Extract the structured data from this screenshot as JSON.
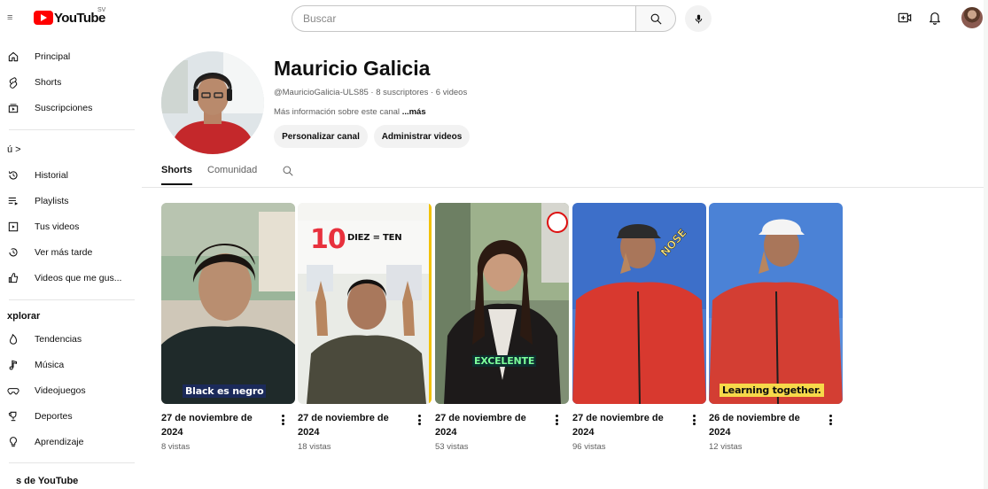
{
  "topbar": {
    "logo_text": "YouTube",
    "logo_country": "SV",
    "search_placeholder": "Buscar"
  },
  "sidebar": {
    "main_items": [
      {
        "label": "Principal",
        "icon": "home-icon"
      },
      {
        "label": "Shorts",
        "icon": "shorts-icon"
      },
      {
        "label": "Suscripciones",
        "icon": "subscriptions-icon"
      }
    ],
    "you_header": "ú  >",
    "you_items": [
      {
        "label": "Historial",
        "icon": "history-icon"
      },
      {
        "label": "Playlists",
        "icon": "playlists-icon"
      },
      {
        "label": "Tus videos",
        "icon": "your-videos-icon"
      },
      {
        "label": "Ver más tarde",
        "icon": "watch-later-icon"
      },
      {
        "label": "Videos que me gus...",
        "icon": "liked-videos-icon"
      }
    ],
    "explore_title": "xplorar",
    "explore_items": [
      {
        "label": "Tendencias",
        "icon": "trending-icon"
      },
      {
        "label": "Música",
        "icon": "music-icon"
      },
      {
        "label": "Videojuegos",
        "icon": "gaming-icon"
      },
      {
        "label": "Deportes",
        "icon": "sports-icon"
      },
      {
        "label": "Aprendizaje",
        "icon": "learning-icon"
      }
    ],
    "more_title": "s de YouTube"
  },
  "channel": {
    "name": "Mauricio Galicia",
    "meta": "@MauricioGalicia-ULS85 · 8 suscriptores · 6 videos",
    "more_info": "Más información sobre este canal",
    "more_link": "...más",
    "customize_button": "Personalizar canal",
    "manage_button": "Administrar videos",
    "tabs": [
      {
        "label": "Shorts",
        "active": true
      },
      {
        "label": "Comunidad",
        "active": false
      }
    ]
  },
  "shorts": [
    {
      "title": "27 de noviembre de 2024",
      "views": "8 vistas",
      "caption": "Black es negro"
    },
    {
      "title": "27 de noviembre de 2024",
      "views": "18 vistas",
      "caption_number": "10",
      "caption_word": "DIEZ = TEN"
    },
    {
      "title": "27 de noviembre de 2024",
      "views": "53 vistas",
      "caption": "EXCELENTE"
    },
    {
      "title": "27 de noviembre de 2024",
      "views": "96 vistas",
      "caption": "NOSE"
    },
    {
      "title": "26 de noviembre de 2024",
      "views": "12 vistas",
      "caption": "Learning together."
    }
  ],
  "colors": {
    "brand_red": "#ff0000",
    "text_primary": "#0f0f0f",
    "text_secondary": "#606060",
    "pill_bg": "#f2f2f2"
  }
}
